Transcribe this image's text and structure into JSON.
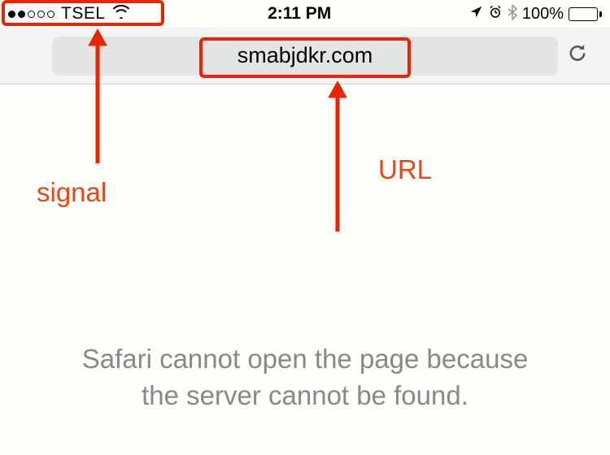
{
  "status": {
    "carrier": "TSEL",
    "time": "2:11 PM",
    "battery_pct": "100%"
  },
  "url_bar": {
    "url": "smabjdkr.com"
  },
  "page": {
    "error_message": "Safari cannot open the page because the server cannot be found."
  },
  "annotations": {
    "signal_label": "signal",
    "url_label": "URL"
  }
}
